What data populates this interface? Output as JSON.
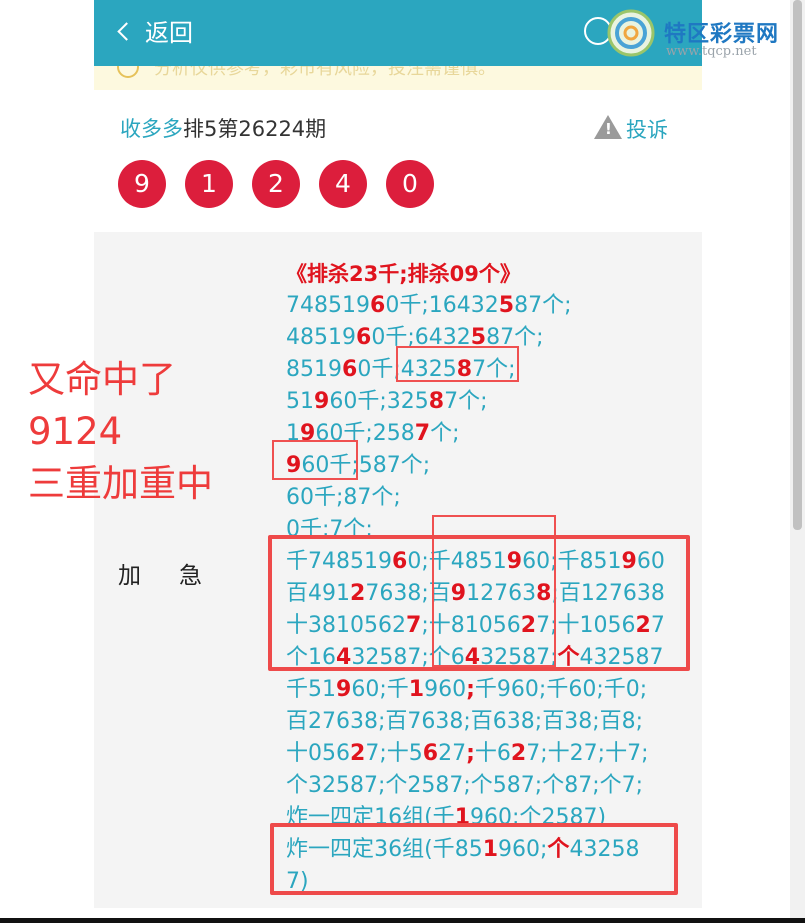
{
  "header": {
    "back_label": "返回",
    "logo_text": "特区彩票网",
    "logo_url": "www.tqcp.net"
  },
  "notice": {
    "text": "分析仅供参考，彩市有风险，投注需谨慎。"
  },
  "post": {
    "author": "收多多",
    "title": "排5第26224期",
    "complain_label": "投诉",
    "balls": [
      "9",
      "1",
      "2",
      "4",
      "0"
    ]
  },
  "content": {
    "lines": [
      "《排杀23千;排杀09个》",
      "74851960千;16432587个;",
      "4851960千;6432587个;",
      "851960千;432587个;",
      "51960千;32587个;",
      "1960千;2587个;",
      "960千;587个;",
      "60千;87个;",
      "0千;7个;",
      "千7485196 0;千4851960;千851960",
      "百49127638;百9127638;百127638",
      "十38105627;十8105627;十105627",
      "个16432587;个6432587;个432587",
      "千51960;千1960;千960;千60;千0;",
      "百27638;百7638;百638;百38;百8;",
      "十05627;十5627;十627;十27;十7;",
      "个32587;个2587;个587;个87;个7;",
      "炸一四定16组(千1960;个2587)",
      "炸一四定36组(千851960;个43258",
      "7)"
    ],
    "label_jiaji": "加急"
  },
  "annotation": {
    "line1": "又命中了",
    "line2": "9124",
    "line3": "三重加重中"
  },
  "colors": {
    "header_bg": "#2ba6bf",
    "ball_red": "#dc1e3c",
    "text_teal": "#2ba6bf",
    "highlight_red": "#e0141e",
    "annotation_red": "#ee3b3b"
  }
}
